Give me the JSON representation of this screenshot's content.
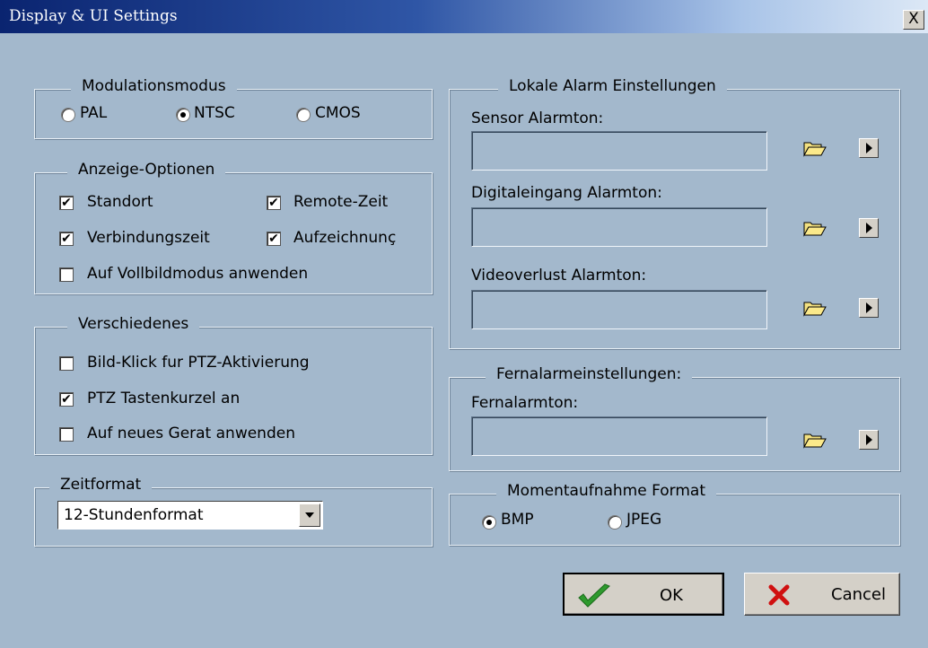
{
  "window": {
    "title": "Display & UI Settings",
    "close_glyph": "X"
  },
  "modulation": {
    "legend": "Modulationsmodus",
    "options": [
      {
        "label": "PAL",
        "selected": false
      },
      {
        "label": "NTSC",
        "selected": true
      },
      {
        "label": "CMOS",
        "selected": false
      }
    ]
  },
  "display_options": {
    "legend": "Anzeige-Optionen",
    "items": [
      {
        "label": "Standort",
        "checked": true
      },
      {
        "label": "Remote-Zeit",
        "checked": true
      },
      {
        "label": "Verbindungszeit",
        "checked": true
      },
      {
        "label": "Aufzeichnunç",
        "checked": true
      },
      {
        "label": "Auf Vollbildmodus anwenden",
        "checked": false
      }
    ]
  },
  "misc": {
    "legend": "Verschiedenes",
    "items": [
      {
        "label": "Bild-Klick fur PTZ-Aktivierung",
        "checked": false
      },
      {
        "label": "PTZ Tastenkurzel an",
        "checked": true
      },
      {
        "label": "Auf neues Gerat anwenden",
        "checked": false
      }
    ]
  },
  "time_format": {
    "legend": "Zeitformat",
    "selected": "12-Stundenformat"
  },
  "local_alarm": {
    "legend": "Lokale Alarm Einstellungen",
    "sensor_label": "Sensor Alarmton:",
    "digital_label": "Digitaleingang Alarmton:",
    "video_label": "Videoverlust Alarmton:",
    "sensor_value": "",
    "digital_value": "",
    "video_value": ""
  },
  "remote_alarm": {
    "legend": "Fernalarmeinstellungen:",
    "label": "Fernalarmton:",
    "value": ""
  },
  "snapshot": {
    "legend": "Momentaufnahme Format",
    "options": [
      {
        "label": "BMP",
        "selected": true
      },
      {
        "label": "JPEG",
        "selected": false
      }
    ]
  },
  "buttons": {
    "ok": "OK",
    "cancel": "Cancel"
  },
  "icons": {
    "browse": "folder-icon",
    "play": "play-icon",
    "ok": "checkmark-icon",
    "cancel": "red-x-icon"
  },
  "colors": {
    "background": "#a3b8cc",
    "title_start": "#0a2470",
    "ok_check": "#2e9a2e",
    "cancel_x": "#d01010"
  }
}
